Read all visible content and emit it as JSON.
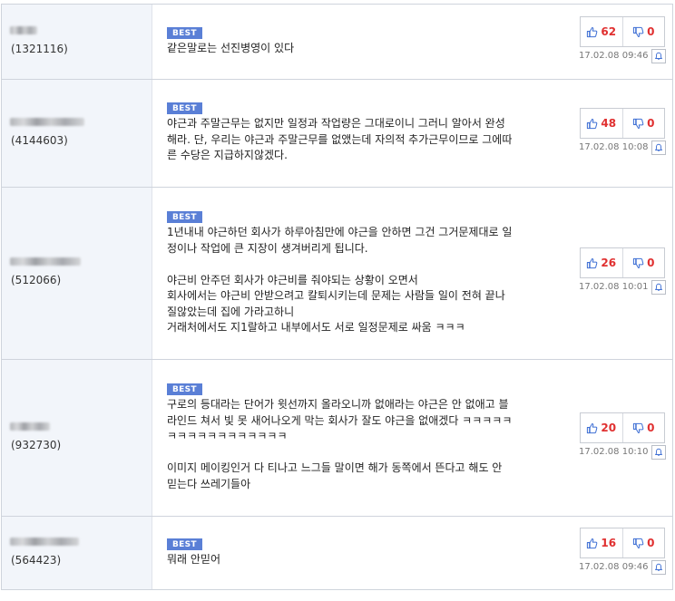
{
  "best_label": "BEST",
  "colors": {
    "best_badge": "#5a7fd6",
    "vote_count": "#e03030",
    "user_column_bg": "#f2f5fa"
  },
  "comments": [
    {
      "user_id": "(1321116)",
      "lines": [
        "같은말로는 선진병영이 있다"
      ],
      "up": "62",
      "down": "0",
      "date": "17.02.08 09:46"
    },
    {
      "user_id": "(4144603)",
      "lines": [
        "야근과 주말근무는 없지만 일정과 작업량은 그대로이니 그러니 알아서 완성",
        "해라. 단, 우리는 야근과 주말근무를 없앴는데 자의적 추가근무이므로 그에따",
        "른 수당은 지급하지않겠다."
      ],
      "up": "48",
      "down": "0",
      "date": "17.02.08 10:08"
    },
    {
      "user_id": "(512066)",
      "lines": [
        "1년내내 야근하던 회사가 하루아침만에 야근을 안하면 그건 그거문제대로 일",
        "정이나 작업에 큰 지장이 생겨버리게 됩니다.",
        "",
        "야근비 안주던 회사가 야근비를 줘야되는 상황이 오면서",
        "회사에서는 야근비 안받으려고 칼퇴시키는데 문제는 사람들 일이 전혀 끝나",
        "질않았는데 집에 가라고하니",
        "거래처에서도 지1랄하고 내부에서도 서로 일정문제로 싸움 ㅋㅋㅋ"
      ],
      "up": "26",
      "down": "0",
      "date": "17.02.08 10:01"
    },
    {
      "user_id": "(932730)",
      "lines": [
        "구로의 등대라는 단어가 윗선까지 올라오니까 없애라는 야근은 안 없애고 블",
        "라인드 쳐서 빛 못 새어나오게 막는 회사가 잘도 야근을 없애겠다 ㅋㅋㅋㅋㅋ",
        "ㅋㅋㅋㅋㅋㅋㅋㅋㅋㅋㅋㅋ",
        "",
        "이미지 메이킹인거 다 티나고 느그들 말이면 해가 동쪽에서 뜬다고 해도 안",
        "믿는다 쓰레기들아"
      ],
      "up": "20",
      "down": "0",
      "date": "17.02.08 10:10"
    },
    {
      "user_id": "(564423)",
      "lines": [
        "뭐래 안믿어"
      ],
      "up": "16",
      "down": "0",
      "date": "17.02.08 09:46"
    }
  ]
}
